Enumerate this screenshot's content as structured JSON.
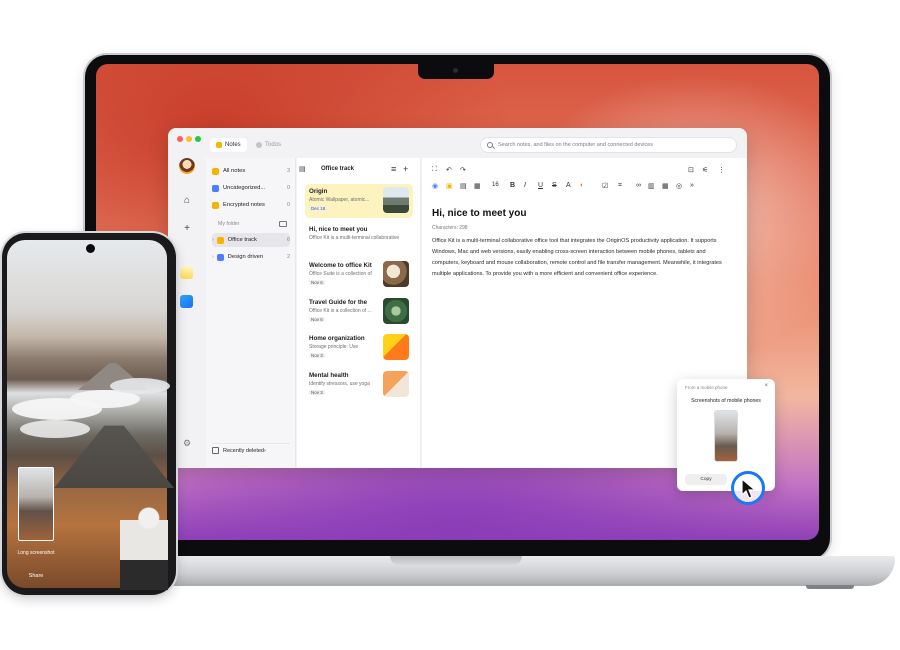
{
  "app": {
    "tabs": [
      {
        "label": "Notes"
      },
      {
        "label": "Todos"
      }
    ],
    "search_placeholder": "Search notes, and files on the computer and connected devices"
  },
  "folders": {
    "items": [
      {
        "label": "All notes",
        "count": "3"
      },
      {
        "label": "Uncategorized...",
        "count": "0"
      },
      {
        "label": "Encrypted notes",
        "count": "0"
      }
    ],
    "my_folder_label": "My folder",
    "my_folder_items": [
      {
        "label": "Office track",
        "count": "6"
      },
      {
        "label": "Design driven",
        "count": "2"
      }
    ],
    "recently_deleted": "Recently deleted"
  },
  "list": {
    "title": "Office track",
    "notes": [
      {
        "title": "Origin",
        "subtitle": "Atomic Wallpaper, atomic...",
        "date": "Dec 18"
      },
      {
        "title": "Hi, nice to meet you",
        "subtitle": "Office Kit is a multi-terminal collaborative",
        "date": ""
      },
      {
        "title": "Welcome to office Kit",
        "subtitle": "Office Suite is a collection of",
        "date": "Nov 6"
      },
      {
        "title": "Travel Guide for the",
        "subtitle": "Office Kit is a collection of ...",
        "date": "Nov 6"
      },
      {
        "title": "Home organization",
        "subtitle": "Storage principle: Use",
        "date": "Nov 3"
      },
      {
        "title": "Mental health",
        "subtitle": "Identify stressors, use yoga",
        "date": "Nov 3"
      }
    ]
  },
  "editor": {
    "font_size": "16",
    "title": "Hi, nice to meet you",
    "meta": "Characters: 298",
    "body": "Office Kit is a multi-terminal collaborative office tool that integrates the OriginOS productivity application. It supports Windows, Mac and web versions, easily enabling cross-screen interaction between mobile phones, tablets and computers, keyboard and mouse collaboration, remote control and file transfer management. Meanwhile, it integrates multiple applications. To provide you with a more efficient and convenient office experience."
  },
  "popup": {
    "source": "From a mobile phone",
    "title": "Screenshots of mobile phones",
    "copy_label": "Copy",
    "close": "×"
  },
  "phone": {
    "shot_label": "Long screenshot",
    "share_label": "Share"
  },
  "colors": {
    "accent_blue": "#1a78f2",
    "selected_note": "#fdf3bf",
    "folder_yellow": "#f5b400"
  }
}
